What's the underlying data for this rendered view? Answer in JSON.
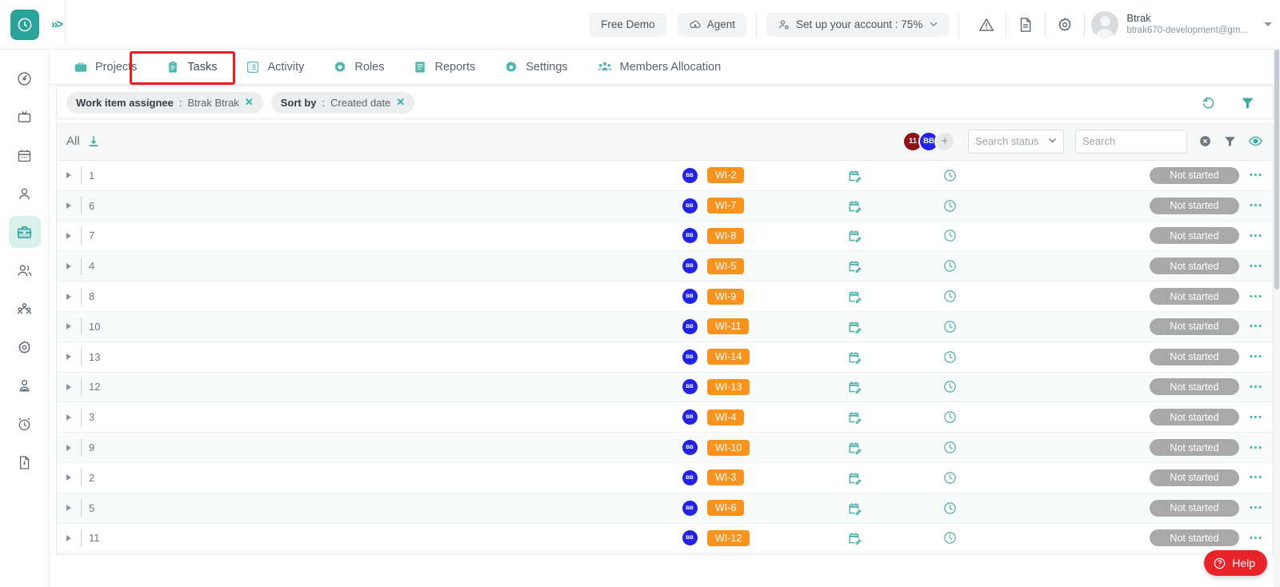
{
  "topbar": {
    "logo_icon": "clock-logo-icon",
    "expand_icon": "chevrons-right-icon",
    "free_demo_label": "Free Demo",
    "agent_label": "Agent",
    "agent_icon": "cloud-download-icon",
    "setup_label": "Set up your account : 75%",
    "setup_icon": "user-settings-icon",
    "warning_icon": "warning-triangle-icon",
    "doc_icon": "document-icon",
    "settings_icon": "gear-icon",
    "user_name": "Btrak",
    "user_email": "btrak670-development@gm...",
    "user_caret_icon": "chevron-down-icon"
  },
  "rail": {
    "items": [
      {
        "name": "target-icon",
        "active": false
      },
      {
        "name": "tv-screen-icon",
        "active": false
      },
      {
        "name": "calendar-icon",
        "active": false
      },
      {
        "name": "user-icon",
        "active": false
      },
      {
        "name": "briefcase-icon",
        "active": true
      },
      {
        "name": "users-icon",
        "active": false
      },
      {
        "name": "team-group-icon",
        "active": false
      },
      {
        "name": "gear-icon",
        "active": false
      },
      {
        "name": "person-badge-icon",
        "active": false
      },
      {
        "name": "alarm-clock-icon",
        "active": false
      },
      {
        "name": "invoice-icon",
        "active": false
      }
    ]
  },
  "tabs": [
    {
      "label": "Projects",
      "icon": "briefcase-icon",
      "active": false
    },
    {
      "label": "Tasks",
      "icon": "clipboard-icon",
      "active": true
    },
    {
      "label": "Activity",
      "icon": "list-box-icon",
      "active": false
    },
    {
      "label": "Roles",
      "icon": "target-gear-icon",
      "active": false
    },
    {
      "label": "Reports",
      "icon": "report-icon",
      "active": false
    },
    {
      "label": "Settings",
      "icon": "gear-icon",
      "active": false
    },
    {
      "label": "Members Allocation",
      "icon": "group-icon",
      "active": false
    }
  ],
  "filters": {
    "chips": [
      {
        "key": "Work item assignee",
        "value": "Btrak Btrak",
        "close_icon": "close-icon"
      },
      {
        "key": "Sort by",
        "value": "Created date",
        "close_icon": "close-icon"
      }
    ],
    "reset_icon": "undo-reset-icon",
    "filter_icon": "funnel-icon"
  },
  "toolbar": {
    "all_label": "All",
    "download_icon": "download-icon",
    "avatars": [
      {
        "initials": "11",
        "color": "#8d1317"
      },
      {
        "initials": "BB",
        "color": "#2323e6"
      }
    ],
    "add_avatar_label": "+",
    "status_select_value": "Search status",
    "status_caret_icon": "chevron-down-icon",
    "search_placeholder": "Search",
    "search_value": "",
    "clear_icon": "clear-circle-icon",
    "filter_icon": "funnel-icon",
    "eye_icon": "eye-icon"
  },
  "table": {
    "expand_icon": "expand-triangle-icon",
    "calendar_icon": "calendar-edit-icon",
    "clock_icon": "clock-icon",
    "more_icon": "more-options-icon",
    "rows": [
      {
        "num": "1",
        "avatar": "BB",
        "tag": "WI-2",
        "status": "Not started"
      },
      {
        "num": "6",
        "avatar": "BB",
        "tag": "WI-7",
        "status": "Not started"
      },
      {
        "num": "7",
        "avatar": "BB",
        "tag": "WI-8",
        "status": "Not started"
      },
      {
        "num": "4",
        "avatar": "BB",
        "tag": "WI-5",
        "status": "Not started"
      },
      {
        "num": "8",
        "avatar": "BB",
        "tag": "WI-9",
        "status": "Not started"
      },
      {
        "num": "10",
        "avatar": "BB",
        "tag": "WI-11",
        "status": "Not started"
      },
      {
        "num": "13",
        "avatar": "BB",
        "tag": "WI-14",
        "status": "Not started"
      },
      {
        "num": "12",
        "avatar": "BB",
        "tag": "WI-13",
        "status": "Not started"
      },
      {
        "num": "3",
        "avatar": "BB",
        "tag": "WI-4",
        "status": "Not started"
      },
      {
        "num": "9",
        "avatar": "BB",
        "tag": "WI-10",
        "status": "Not started"
      },
      {
        "num": "2",
        "avatar": "BB",
        "tag": "WI-3",
        "status": "Not started"
      },
      {
        "num": "5",
        "avatar": "BB",
        "tag": "WI-6",
        "status": "Not started"
      },
      {
        "num": "11",
        "avatar": "BB",
        "tag": "WI-12",
        "status": "Not started"
      }
    ]
  },
  "help": {
    "label": "Help",
    "icon": "question-circle-icon"
  },
  "colors": {
    "brand_teal": "#2aa39a",
    "tag_orange": "#f7931e",
    "status_grey": "#a9a9a9",
    "help_red": "#e8232a",
    "highlight_red": "#f01a1a",
    "avatar_blue": "#2323e6"
  }
}
